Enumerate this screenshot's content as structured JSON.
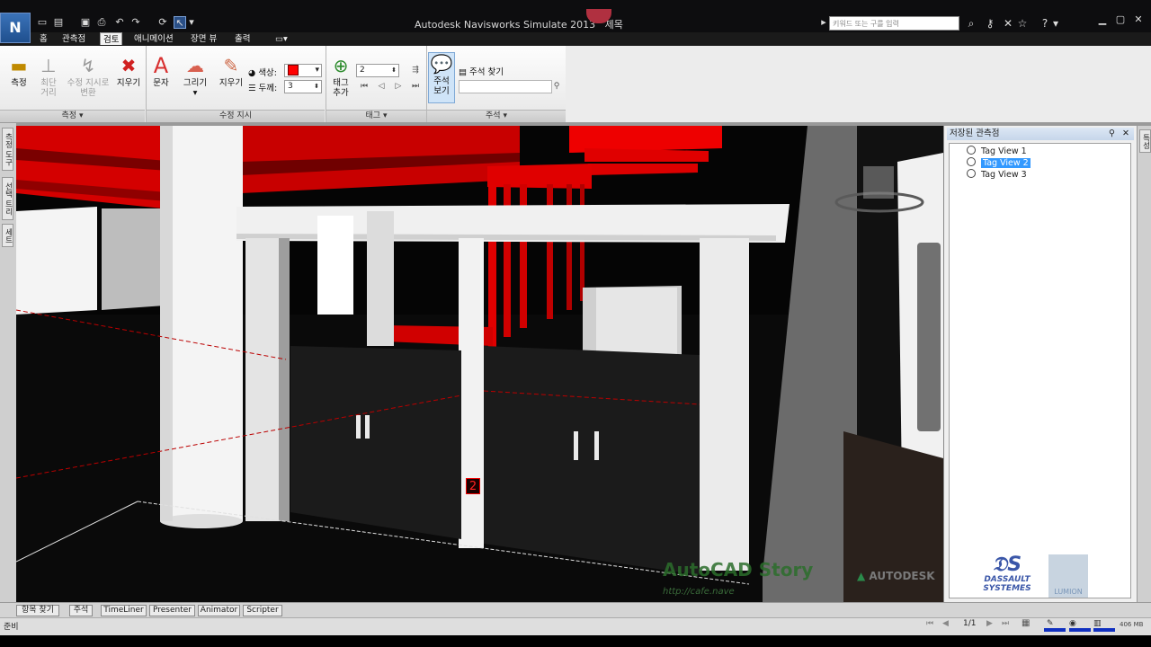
{
  "window": {
    "title": "Autodesk Navisworks Simulate 2013",
    "title_suffix": "제목",
    "search_placeholder": "키워드 또는 구를 입력",
    "logo_text": "N"
  },
  "ribbon_tabs": [
    {
      "label": "홈"
    },
    {
      "label": "관측점"
    },
    {
      "label": "검토",
      "active": true
    },
    {
      "label": "애니메이션"
    },
    {
      "label": "장면 뷰"
    },
    {
      "label": "출력"
    }
  ],
  "ribbon": {
    "measure": {
      "measure_label": "측정",
      "shortest_label_1": "최단",
      "shortest_label_2": "거리",
      "transform_label_1": "수정 지시로",
      "transform_label_2": "변환",
      "clear_label": "지우기",
      "panel_title": "측정"
    },
    "redline": {
      "text_label": "문자",
      "draw_label": "그리기",
      "erase_label": "지우기",
      "color_label": "색상:",
      "thickness_label": "두께:",
      "thickness_value": "3",
      "color_value": "#ff0000",
      "panel_title": "수정 지시"
    },
    "tags": {
      "add_tag_label_1": "태그",
      "add_tag_label_2": "추가",
      "tag_id_value": "2",
      "panel_title": "태그"
    },
    "comments": {
      "view_label_1": "주석",
      "view_label_2": "보기",
      "find_comments_label": "주석 찾기",
      "panel_title": "주석"
    }
  },
  "left_dock_tabs": [
    {
      "label": "측정 도구"
    },
    {
      "label": "선택 트리"
    },
    {
      "label": "세트"
    }
  ],
  "viewport": {
    "tag_marker": "2",
    "watermark_title": "AutoCAD Story",
    "watermark_url": "http://cafe.nave",
    "logos": [
      "AUTODESK",
      "DASSAULT SYSTEMES",
      "LUMION"
    ]
  },
  "saved_views_panel": {
    "title": "저장된 관측점",
    "items": [
      {
        "label": "Tag View 1",
        "selected": false
      },
      {
        "label": "Tag View 2",
        "selected": true
      },
      {
        "label": "Tag View 3",
        "selected": false
      }
    ]
  },
  "right_dock_tab": "특성",
  "bottom_tabs": [
    {
      "label": "항목 찾기"
    },
    {
      "label": "주석"
    },
    {
      "label": "TimeLiner"
    },
    {
      "label": "Presenter"
    },
    {
      "label": "Animator"
    },
    {
      "label": "Scripter"
    }
  ],
  "status": {
    "text": "준비",
    "page": "1/1",
    "memory": "406 MB"
  }
}
